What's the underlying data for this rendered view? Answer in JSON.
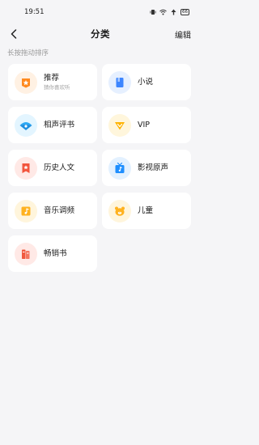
{
  "status": {
    "time": "19:51",
    "battery": "66"
  },
  "header": {
    "title": "分类",
    "edit_label": "编辑"
  },
  "hint": "长按拖动排序",
  "categories": [
    {
      "label": "推荐",
      "sub": "猜你喜欢听",
      "icon": "star-badge-icon",
      "bg": "#fff1e3",
      "color": "#ff8a1f"
    },
    {
      "label": "小说",
      "icon": "book-icon",
      "bg": "#e6f0ff",
      "color": "#3d86ff"
    },
    {
      "label": "相声评书",
      "icon": "fan-icon",
      "bg": "#e3f5ff",
      "color": "#2aa9f5"
    },
    {
      "label": "VIP",
      "icon": "vip-diamond-icon",
      "bg": "#fff6dc",
      "color": "#ffb300"
    },
    {
      "label": "历史人文",
      "icon": "bookmark-star-icon",
      "bg": "#ffe9e6",
      "color": "#f2553d"
    },
    {
      "label": "影视原声",
      "icon": "tv-music-icon",
      "bg": "#e3f1ff",
      "color": "#1f8fff"
    },
    {
      "label": "音乐调频",
      "icon": "music-note-icon",
      "bg": "#fff5dc",
      "color": "#ffb21f"
    },
    {
      "label": "儿童",
      "icon": "bear-icon",
      "bg": "#fff5dc",
      "color": "#ffb21f"
    },
    {
      "label": "畅销书",
      "icon": "books-icon",
      "bg": "#ffe9e6",
      "color": "#f0593f"
    }
  ]
}
